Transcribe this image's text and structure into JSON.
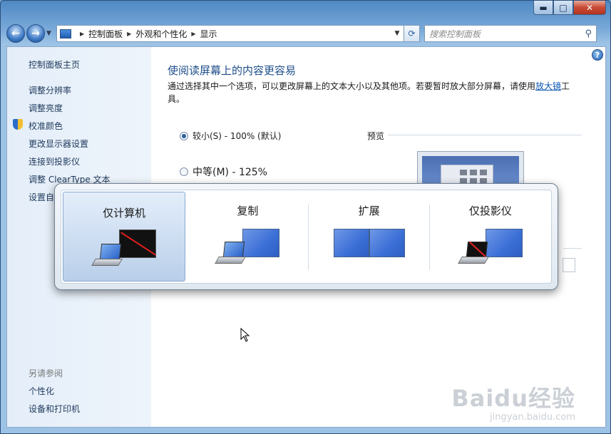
{
  "window": {
    "caption_buttons": [
      "minimize",
      "maximize",
      "close"
    ]
  },
  "navbar": {
    "breadcrumb": [
      "控制面板",
      "外观和个性化",
      "显示"
    ],
    "search_placeholder": "搜索控制面板"
  },
  "sidebar": {
    "home": "控制面板主页",
    "links": [
      "调整分辨率",
      "调整亮度",
      "校准颜色",
      "更改显示器设置",
      "连接到投影仪",
      "调整 ClearType 文本",
      "设置自"
    ],
    "see_also_heading": "另请参阅",
    "see_also": [
      "个性化",
      "设备和打印机"
    ]
  },
  "main": {
    "title": "使阅读屏幕上的内容更容易",
    "desc_before": "通过选择其中一个选项，可以更改屏幕上的文本大小以及其他项。若要暂时放大部分屏幕，请使用",
    "desc_link": "放大镜",
    "desc_after": "工具。",
    "options": [
      {
        "label": "较小(S) - 100% (默认)",
        "checked": true
      },
      {
        "label": "中等(M) - 125%",
        "checked": false
      }
    ],
    "preview_label": "预览"
  },
  "projection": {
    "options": [
      {
        "label": "仅计算机",
        "selected": true
      },
      {
        "label": "复制",
        "selected": false
      },
      {
        "label": "扩展",
        "selected": false
      },
      {
        "label": "仅投影仪",
        "selected": false
      }
    ]
  },
  "watermark": {
    "main": "Baidu经验",
    "sub": "jingyan.baidu.com"
  },
  "colors": {
    "link": "#0b57b3",
    "title": "#1e4f8a",
    "selected_option": "#b9cfea"
  }
}
